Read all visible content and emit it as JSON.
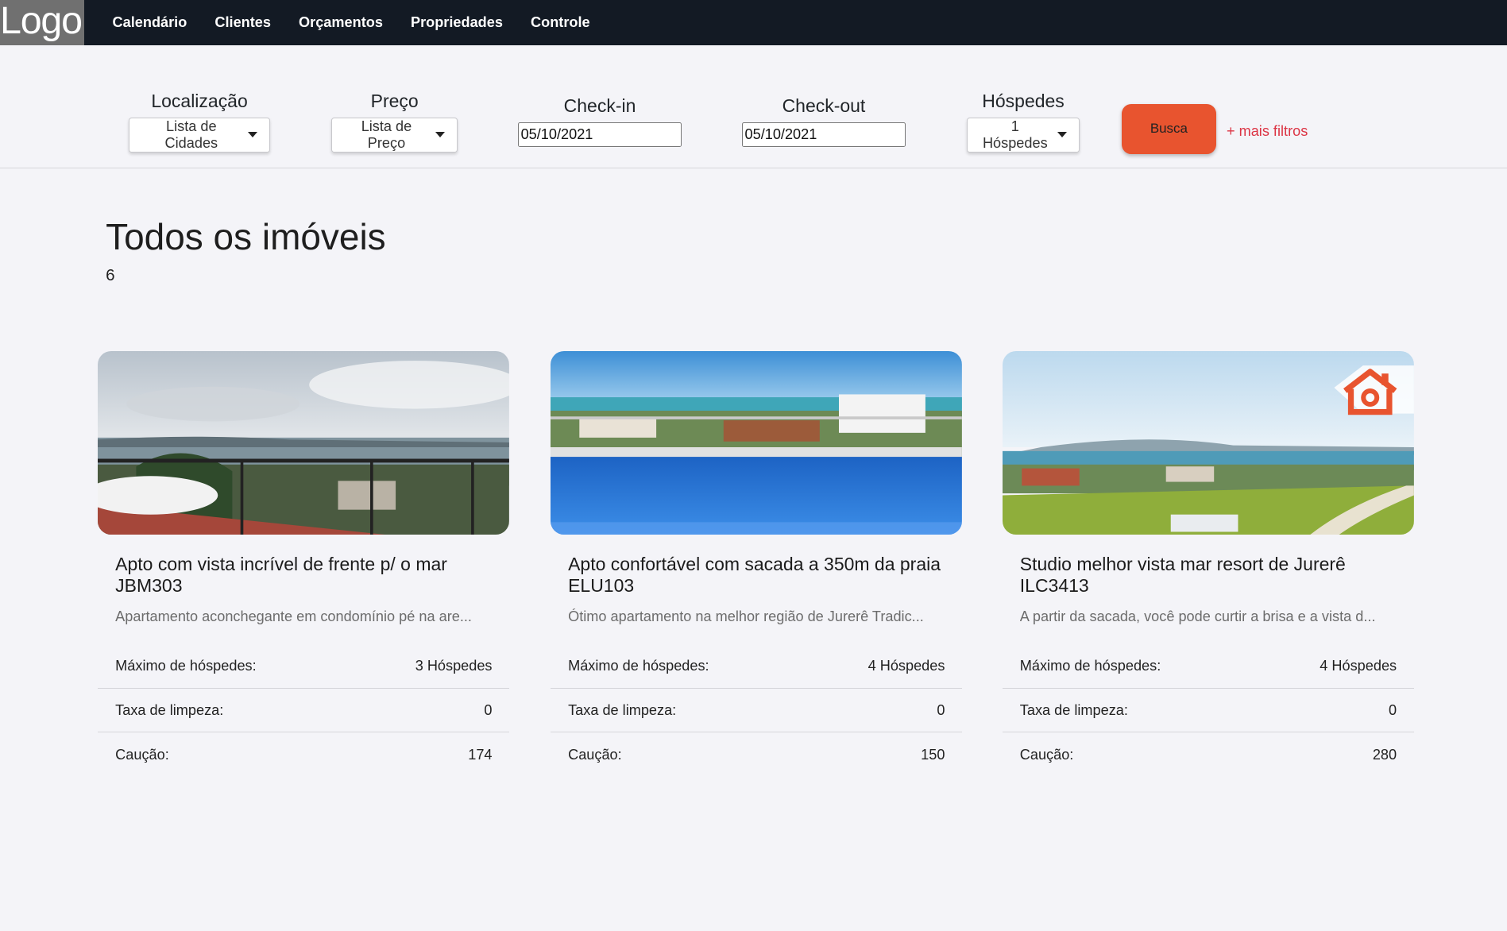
{
  "nav": {
    "logo": "Logo",
    "links": [
      "Calendário",
      "Clientes",
      "Orçamentos",
      "Propriedades",
      "Controle"
    ]
  },
  "filters": {
    "location_label": "Localização",
    "location_value": "Lista de Cidades",
    "price_label": "Preço",
    "price_value": "Lista de Preço",
    "checkin_label": "Check-in",
    "checkin_value": "05/10/2021",
    "checkout_label": "Check-out",
    "checkout_value": "05/10/2021",
    "guests_label": "Hóspedes",
    "guests_value": "1 Hóspedes",
    "search_button": "Busca",
    "more_filters": "+ mais filtros"
  },
  "main": {
    "title": "Todos os imóveis",
    "count": "6"
  },
  "properties": [
    {
      "title": "Apto com vista incrível de frente p/ o mar JBM303",
      "description": "Apartamento aconchegante em condomínio pé na are...",
      "max_guests_label": "Máximo de hóspedes:",
      "max_guests": "3 Hóspedes",
      "cleaning_label": "Taxa de limpeza:",
      "cleaning": "0",
      "deposit_label": "Caução:",
      "deposit": "174"
    },
    {
      "title": "Apto confortável com sacada a 350m da praia ELU103",
      "description": "Ótimo apartamento na melhor região de Jurerê Tradic...",
      "max_guests_label": "Máximo de hóspedes:",
      "max_guests": "4 Hóspedes",
      "cleaning_label": "Taxa de limpeza:",
      "cleaning": "0",
      "deposit_label": "Caução:",
      "deposit": "150"
    },
    {
      "title": "Studio melhor vista mar resort de Jurerê ILC3413",
      "description": "A partir da sacada, você pode curtir a brisa e a vista d...",
      "max_guests_label": "Máximo de hóspedes:",
      "max_guests": "4 Hóspedes",
      "cleaning_label": "Taxa de limpeza:",
      "cleaning": "0",
      "deposit_label": "Caução:",
      "deposit": "280"
    }
  ],
  "colors": {
    "navbar": "#131a24",
    "accent": "#e8542f",
    "link_red": "#dc3545"
  }
}
